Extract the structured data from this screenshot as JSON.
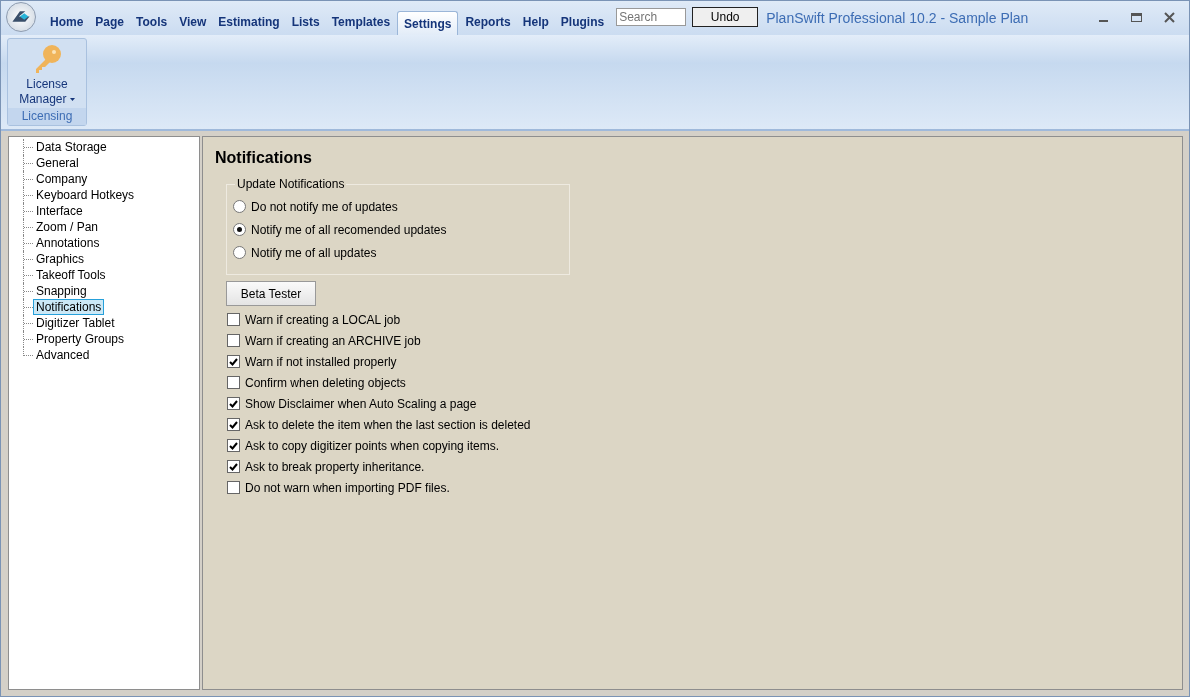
{
  "tabs": [
    {
      "label": "Home",
      "selected": false
    },
    {
      "label": "Page",
      "selected": false
    },
    {
      "label": "Tools",
      "selected": false
    },
    {
      "label": "View",
      "selected": false
    },
    {
      "label": "Estimating",
      "selected": false
    },
    {
      "label": "Lists",
      "selected": false
    },
    {
      "label": "Templates",
      "selected": false
    },
    {
      "label": "Settings",
      "selected": true
    },
    {
      "label": "Reports",
      "selected": false
    },
    {
      "label": "Help",
      "selected": false
    },
    {
      "label": "Plugins",
      "selected": false
    }
  ],
  "search": {
    "placeholder": "Search"
  },
  "undo_button": "Undo",
  "window": {
    "title": "PlanSwift Professional 10.2 - Sample Plan"
  },
  "ribbon": {
    "groups": [
      {
        "label": "Licensing",
        "buttons": [
          {
            "label_line_1": "License",
            "label_line_2": "Manager"
          }
        ]
      }
    ]
  },
  "sidebar": {
    "items": [
      {
        "label": "Data Storage",
        "selected": false
      },
      {
        "label": "General",
        "selected": false
      },
      {
        "label": "Company",
        "selected": false
      },
      {
        "label": "Keyboard Hotkeys",
        "selected": false
      },
      {
        "label": "Interface",
        "selected": false
      },
      {
        "label": "Zoom / Pan",
        "selected": false
      },
      {
        "label": "Annotations",
        "selected": false
      },
      {
        "label": "Graphics",
        "selected": false
      },
      {
        "label": "Takeoff Tools",
        "selected": false
      },
      {
        "label": "Snapping",
        "selected": false
      },
      {
        "label": "Notifications",
        "selected": true
      },
      {
        "label": "Digitizer Tablet",
        "selected": false
      },
      {
        "label": "Property Groups",
        "selected": false
      },
      {
        "label": "Advanced",
        "selected": false
      }
    ]
  },
  "panel": {
    "title": "Notifications",
    "update_group": {
      "label": "Update Notifications",
      "options": [
        {
          "label": "Do not notify me of updates",
          "selected": false
        },
        {
          "label": "Notify me of all recomended updates",
          "selected": true
        },
        {
          "label": "Notify me of all updates",
          "selected": false
        }
      ]
    },
    "beta_button": "Beta Tester",
    "checkboxes": [
      {
        "label": "Warn if creating a LOCAL job",
        "checked": false
      },
      {
        "label": "Warn if creating an ARCHIVE job",
        "checked": false
      },
      {
        "label": "Warn if not installed properly",
        "checked": true
      },
      {
        "label": "Confirm when deleting objects",
        "checked": false
      },
      {
        "label": "Show Disclaimer when Auto Scaling a page",
        "checked": true
      },
      {
        "label": "Ask to delete the item when the last section is deleted",
        "checked": true
      },
      {
        "label": "Ask to copy digitizer points when copying items.",
        "checked": true
      },
      {
        "label": "Ask to break property inheritance.",
        "checked": true
      },
      {
        "label": "Do not warn when importing PDF files.",
        "checked": false
      }
    ]
  }
}
